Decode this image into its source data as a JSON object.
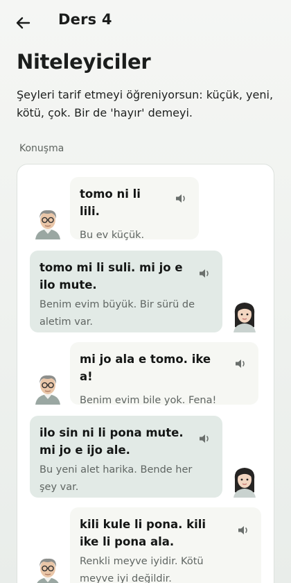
{
  "header": {
    "back_icon": "arrow-left-icon",
    "title": "Ders 4"
  },
  "page": {
    "title": "Niteleyiciler",
    "intro": "Şeyleri tarif etmeyi öğreniyorsun: küçük, yeni, kötü, çok. Bir de 'hayır' demeyi.",
    "section_label": "Konuşma"
  },
  "conversation": [
    {
      "speaker": "old-man",
      "side": "left",
      "toki_pona": "tomo ni li lili.",
      "translation": "Bu ev küçük."
    },
    {
      "speaker": "young-woman",
      "side": "right",
      "toki_pona": "tomo mi li suli. mi jo e ilo mute.",
      "translation": "Benim evim büyük. Bir sürü de aletim var."
    },
    {
      "speaker": "old-man",
      "side": "left",
      "toki_pona": "mi jo ala e tomo. ike a!",
      "translation": "Benim evim bile yok. Fena!"
    },
    {
      "speaker": "young-woman",
      "side": "right",
      "toki_pona": "ilo sin ni li pona mute. mi jo e ijo ale.",
      "translation": "Bu yeni alet harika. Bende her şey var."
    },
    {
      "speaker": "old-man",
      "side": "left",
      "toki_pona": "kili kule li pona. kili ike li pona ala.",
      "translation": "Renkli meyve iyidir. Kötü meyve iyi değildir."
    }
  ],
  "colors": {
    "left_bubble": "#f6f7f3",
    "right_bubble": "#e2eae6",
    "background": "#eef1ee"
  }
}
